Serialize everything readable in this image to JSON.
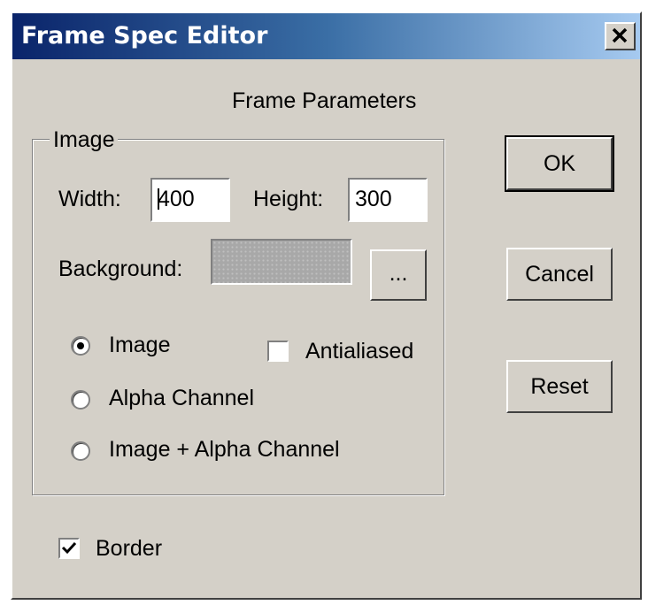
{
  "window": {
    "title": "Frame Spec Editor"
  },
  "dialog": {
    "heading": "Frame Parameters",
    "group": {
      "label": "Image",
      "width_label": "Width:",
      "width_value": "400",
      "height_label": "Height:",
      "height_value": "300",
      "background_label": "Background:",
      "browse_label": "...",
      "radios": [
        {
          "label": "Image",
          "checked": true
        },
        {
          "label": "Alpha Channel",
          "checked": false
        },
        {
          "label": "Image + Alpha Channel",
          "checked": false
        }
      ],
      "antialiased": {
        "label": "Antialiased",
        "checked": false
      }
    },
    "border": {
      "label": "Border",
      "checked": true
    },
    "buttons": {
      "ok": "OK",
      "cancel": "Cancel",
      "reset": "Reset"
    }
  },
  "colors": {
    "face": "#d4d0c8",
    "title_start": "#0a246a",
    "title_end": "#a6caf0",
    "swatch": "#a8a8a8"
  },
  "icons": {
    "close": "close-x-icon",
    "check": "checkmark-icon"
  }
}
